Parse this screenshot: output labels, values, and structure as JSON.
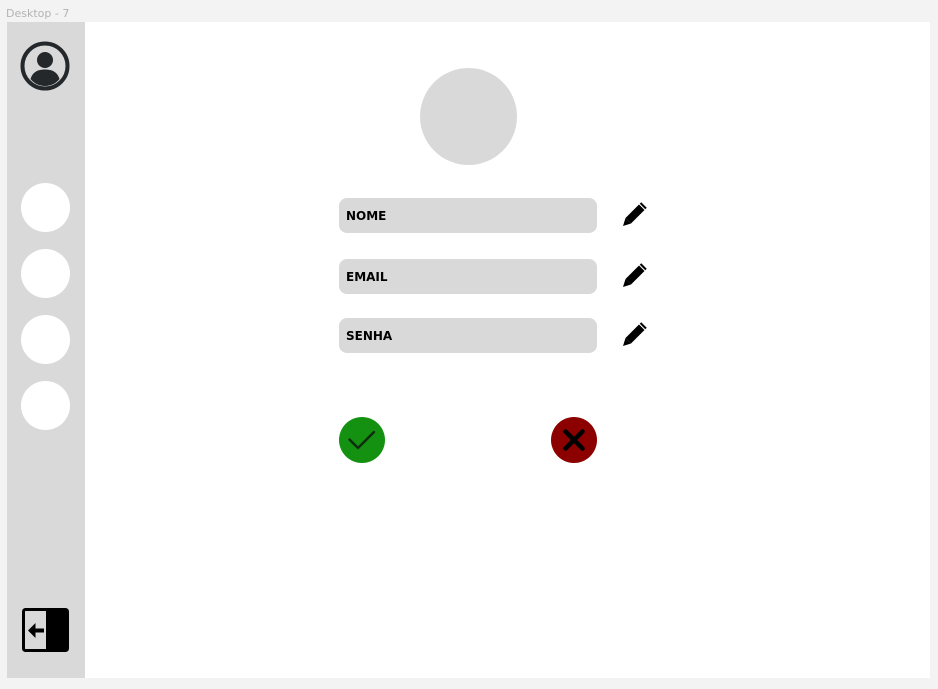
{
  "frame": {
    "title": "Desktop - 7"
  },
  "sidebar": {
    "profile_icon": "user-circle-icon",
    "nav_items": [
      {
        "name": "nav-item-1"
      },
      {
        "name": "nav-item-2"
      },
      {
        "name": "nav-item-3"
      },
      {
        "name": "nav-item-4"
      }
    ],
    "logout_icon": "logout-arrow-icon"
  },
  "form": {
    "fields": [
      {
        "label": "NOME",
        "edit_icon": "pencil-icon"
      },
      {
        "label": "EMAIL",
        "edit_icon": "pencil-icon"
      },
      {
        "label": "SENHA",
        "edit_icon": "pencil-icon"
      }
    ],
    "confirm_icon": "checkmark-icon",
    "cancel_icon": "x-close-icon"
  },
  "colors": {
    "sidebar_bg": "#d9d9d9",
    "field_bg": "#d9d9d9",
    "confirm": "#149111",
    "cancel": "#8d0000",
    "canvas": "#f3f3f3"
  }
}
